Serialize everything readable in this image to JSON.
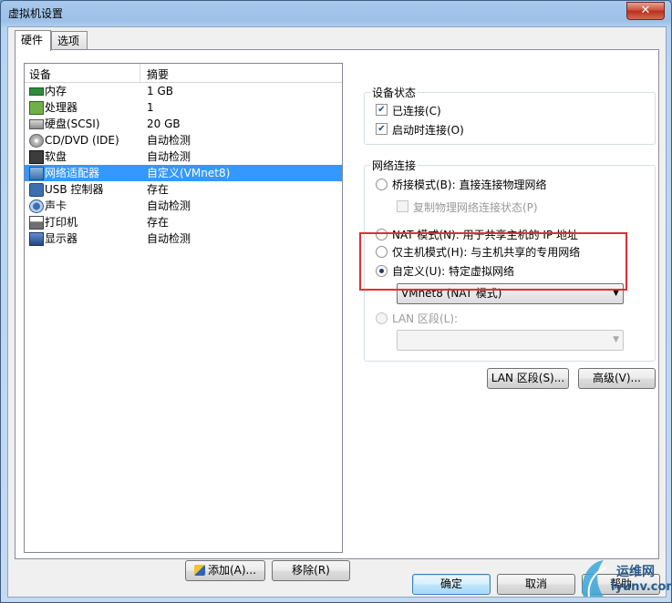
{
  "window": {
    "title": "虚拟机设置",
    "close_glyph": "✕"
  },
  "tabs": [
    {
      "label": "硬件"
    },
    {
      "label": "选项"
    }
  ],
  "device_list": {
    "headers": {
      "device": "设备",
      "summary": "摘要"
    },
    "rows": [
      {
        "name": "内存",
        "summary": "1 GB",
        "icon": "memory-icon"
      },
      {
        "name": "处理器",
        "summary": "1",
        "icon": "processor-icon"
      },
      {
        "name": "硬盘(SCSI)",
        "summary": "20 GB",
        "icon": "hard-disk-icon"
      },
      {
        "name": "CD/DVD (IDE)",
        "summary": "自动检测",
        "icon": "cd-dvd-icon"
      },
      {
        "name": "软盘",
        "summary": "自动检测",
        "icon": "floppy-icon"
      },
      {
        "name": "网络适配器",
        "summary": "自定义(VMnet8)",
        "icon": "network-adapter-icon"
      },
      {
        "name": "USB 控制器",
        "summary": "存在",
        "icon": "usb-icon"
      },
      {
        "name": "声卡",
        "summary": "自动检测",
        "icon": "sound-card-icon"
      },
      {
        "name": "打印机",
        "summary": "存在",
        "icon": "printer-icon"
      },
      {
        "name": "显示器",
        "summary": "自动检测",
        "icon": "display-icon"
      }
    ],
    "selected_index": 5
  },
  "list_buttons": {
    "add": "添加(A)...",
    "remove": "移除(R)"
  },
  "device_status": {
    "legend": "设备状态",
    "connected": {
      "label": "已连接(C)",
      "checked": true
    },
    "connect_at_power_on": {
      "label": "启动时连接(O)",
      "checked": true
    }
  },
  "network_connection": {
    "legend": "网络连接",
    "bridged": {
      "label": "桥接模式(B): 直接连接物理网络"
    },
    "replicate": {
      "label": "复制物理网络连接状态(P)"
    },
    "nat": {
      "label": "NAT 模式(N): 用于共享主机的 IP 地址"
    },
    "host_only": {
      "label": "仅主机模式(H): 与主机共享的专用网络"
    },
    "custom": {
      "label": "自定义(U): 特定虚拟网络",
      "selected": true
    },
    "custom_select": {
      "value": "VMnet8 (NAT 模式)"
    },
    "lan_segment": {
      "label": "LAN 区段(L):"
    },
    "lan_select": {
      "value": ""
    }
  },
  "panel_buttons": {
    "lan_segments": "LAN 区段(S)...",
    "advanced": "高级(V)..."
  },
  "dialog_buttons": {
    "ok": "确定",
    "cancel": "取消",
    "help": "帮助"
  },
  "watermark": {
    "line1": "运维网",
    "line2": "iyunv.com"
  },
  "colors": {
    "selection": "#3399ff",
    "highlight_box": "#e03030",
    "title_gradient": "#a9c9ec"
  }
}
